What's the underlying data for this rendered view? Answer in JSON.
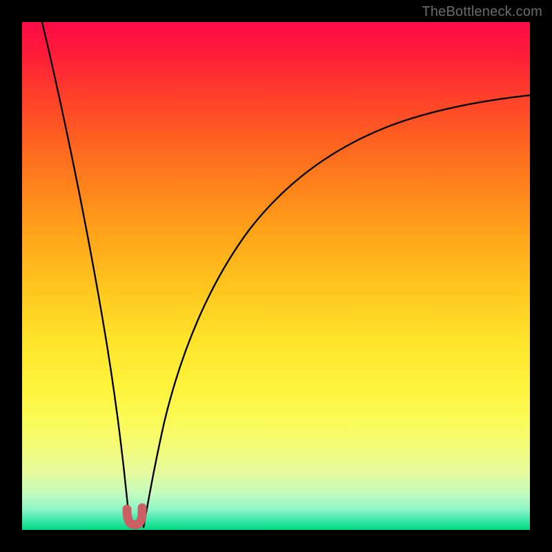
{
  "watermark": {
    "text": "TheBottleneck.com"
  },
  "chart_data": {
    "type": "line",
    "title": "",
    "xlabel": "",
    "ylabel": "",
    "xlim": [
      0,
      100
    ],
    "ylim": [
      0,
      100
    ],
    "series": [
      {
        "name": "left-branch",
        "x": [
          4,
          6,
          8,
          10,
          12,
          14,
          16,
          18,
          19,
          19.5,
          20,
          20.5
        ],
        "y": [
          100,
          88,
          76,
          64,
          52,
          40,
          28,
          16,
          8,
          4,
          1.5,
          0.5
        ]
      },
      {
        "name": "right-branch",
        "x": [
          22,
          23,
          25,
          28,
          32,
          37,
          44,
          52,
          60,
          70,
          80,
          90,
          100
        ],
        "y": [
          0.5,
          3,
          10,
          20,
          32,
          44,
          55,
          64,
          70,
          75,
          78.5,
          81,
          83
        ]
      },
      {
        "name": "marker",
        "x": [
          19.5,
          20,
          20.5,
          21,
          21.5,
          22
        ],
        "y": [
          3.5,
          1.5,
          1,
          1,
          1.5,
          3.5
        ]
      }
    ],
    "background_gradient": {
      "top": "#ff0b47",
      "middle": "#ffe22a",
      "bottom": "#00d981"
    },
    "marker_color": "#c86064"
  }
}
